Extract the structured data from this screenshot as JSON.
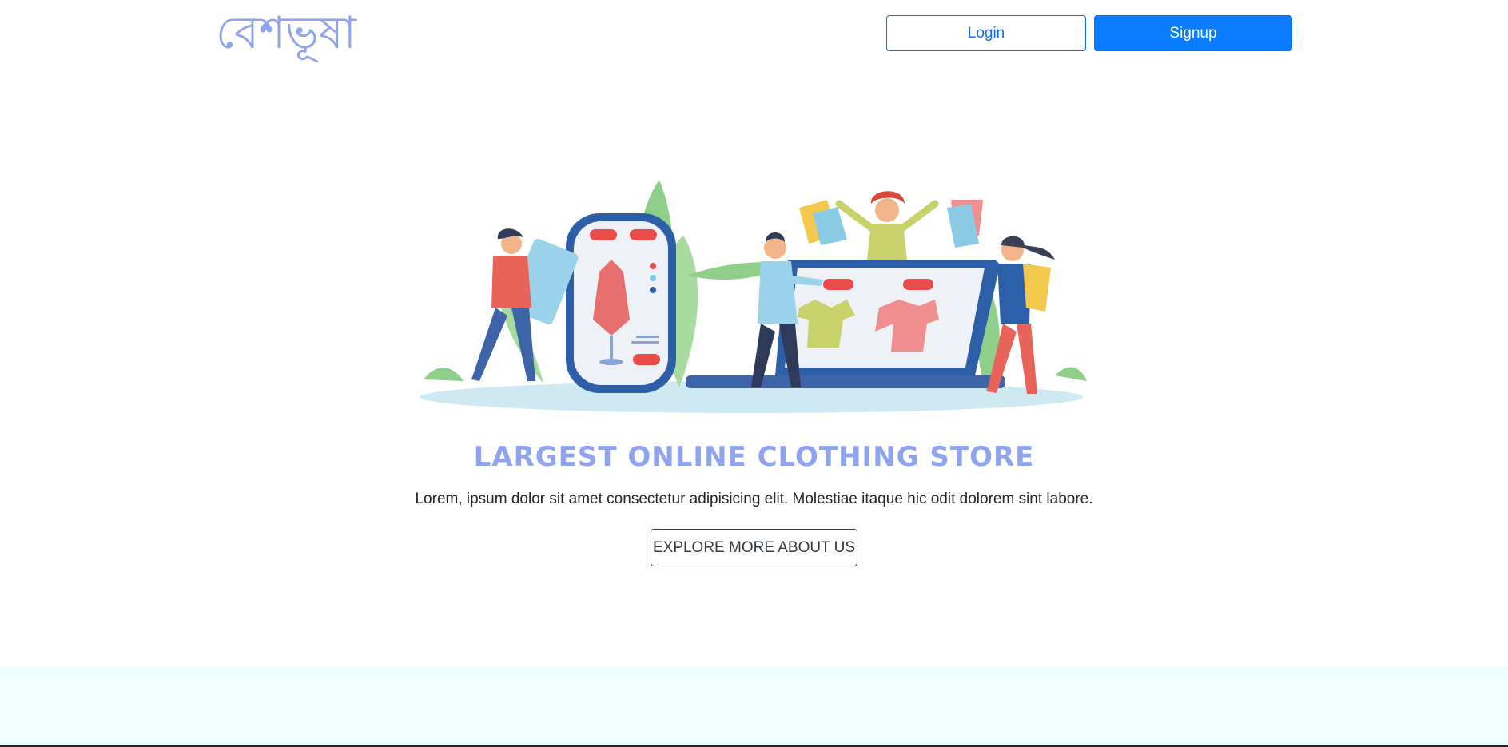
{
  "header": {
    "logo_text": "বেশভূষা",
    "login_label": "Login",
    "signup_label": "Signup"
  },
  "hero": {
    "title": "LARGEST ONLINE CLOTHING STORE",
    "subtitle": "Lorem, ipsum dolor sit amet consectetur adipisicing elit. Molestiae itaque hic odit dolorem sint labore.",
    "explore_label": "EXPLORE MORE ABOUT US"
  },
  "colors": {
    "brand": "#8fa3ef",
    "primary": "#0a7cff",
    "footer_bg": "#efffff"
  }
}
